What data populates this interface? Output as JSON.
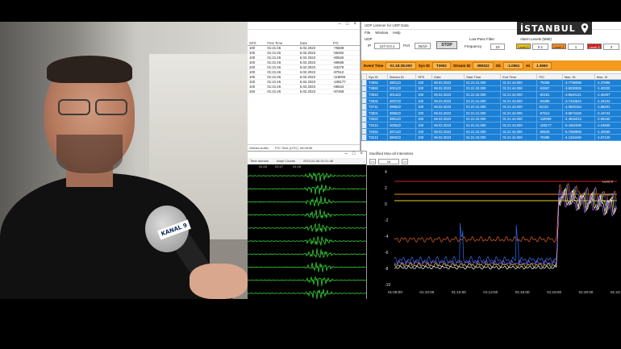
{
  "overlay": {
    "location": "İSTANBUL"
  },
  "camera": {
    "mic_label": "KANAL 9"
  },
  "list_window": {
    "title_controls": [
      "–",
      "□",
      "×"
    ],
    "columns": [
      "SPS",
      "First Time",
      "Date",
      "P/C"
    ],
    "rows": [
      [
        "100",
        "01:21:45",
        "6.02.2023",
        "-75508"
      ],
      [
        "100",
        "01:21:45",
        "6.02.2023",
        "-56492"
      ],
      [
        "100",
        "01:21:45",
        "6.02.2023",
        "-80526"
      ],
      [
        "100",
        "01:21:46",
        "6.02.2023",
        "-69686"
      ],
      [
        "100",
        "01:21:46",
        "6.02.2023",
        "-53279"
      ],
      [
        "100",
        "01:21:46",
        "6.02.2023",
        "-87512"
      ],
      [
        "100",
        "01:21:46",
        "6.02.2023",
        "-118006"
      ],
      [
        "100",
        "01:21:45",
        "6.02.2023",
        "-108177"
      ],
      [
        "100",
        "01:21:45",
        "6.02.2023",
        "-68634"
      ],
      [
        "150",
        "01:21:46",
        "6.02.2023",
        "-87458"
      ]
    ],
    "status": [
      "Stream buffer",
      "P/C Time (UTC): 06:08:56"
    ]
  },
  "udp_window": {
    "title": "UDP Listener for UDP Data",
    "menu": [
      "File",
      "Window",
      "Help"
    ],
    "udp_label": "UDP",
    "ip_label": "IP",
    "ip_value": "127.0.0.1",
    "port_label": "Port",
    "port_value": "26/10",
    "stop_label": "STOP",
    "lowpass_label": "Low-Pass Filter",
    "frequency_label": "Frequency",
    "frequency_value": "10",
    "alarm_label": "Alarm Levels (MMI)",
    "levels": [
      {
        "label": "Level 0",
        "value": "0.1",
        "color": "#e8c020"
      },
      {
        "label": "Level 2",
        "value": "1",
        "color": "#f08a20"
      },
      {
        "label": "Level 3",
        "value": "3",
        "color": "#d42020"
      }
    ],
    "info": {
      "event_time_label": "Event Time",
      "event_time_value": "01:18:28.000",
      "sys_id_label": "Sys ID",
      "sys_id_value": "T3902",
      "stream_id_label": "Stream ID",
      "stream_id_value": "398322",
      "ok_label": "Ok",
      "ok_value": "-1.0961",
      "hi_label": "Hi",
      "hi_value": "1.3650"
    },
    "columns": [
      "Sys ID",
      "Stream ID",
      "SPS",
      "Date",
      "Start Time",
      "End Time",
      "P/C",
      "Max. Dt",
      "Max. I/t"
    ],
    "rows": [
      [
        "T4062",
        "3801Z2",
        "100",
        "06.02.2023",
        "01:21:41.000",
        "01:21:43.000",
        "-76308",
        "-3.7799086",
        "-1.37596"
      ],
      [
        "T3882",
        "3001Z2",
        "100",
        "06.02.2023",
        "01:21:42.000",
        "01:21:44.000",
        "-53557",
        "-3.6030835",
        "-1.40330"
      ],
      [
        "T3942",
        "4014Z2",
        "100",
        "06.02.2023",
        "01:21:42.000",
        "01:21:44.000",
        "-60181",
        "-3.6540141",
        "-1.45407"
      ],
      [
        "T3632",
        "4007Z2",
        "100",
        "06.02.2023",
        "01:21:41.000",
        "01:21:43.000",
        "-54686",
        "-3.7410544",
        "-1.34102"
      ],
      [
        "T3711",
        "3985Z2",
        "100",
        "06.02.2023",
        "01:21:41.000",
        "01:21:43.000",
        "92119",
        "-4.0620154",
        "-1.86201"
      ],
      [
        "T3601",
        "3885Z2",
        "100",
        "06.02.2023",
        "01:21:41.000",
        "01:21:43.000",
        "-67512",
        "-3.5874426",
        "-2.16744"
      ],
      [
        "T3522",
        "3991Z2",
        "100",
        "06.02.2023",
        "01:21:42.000",
        "01:21:44.000",
        "-119009",
        "-4.4815012",
        "-2.06150"
      ],
      [
        "T3412",
        "4005Z2",
        "100",
        "06.02.2023",
        "01:21:41.000",
        "01:21:43.000",
        "-108177",
        "-5.4492030",
        "-1.04605"
      ],
      [
        "T3352",
        "3871Z2",
        "100",
        "06.02.2023",
        "01:21:42.000",
        "01:21:44.000",
        "-68526",
        "-5.7068986",
        "-1.40060"
      ],
      [
        "T3212",
        "3800Z2",
        "100",
        "06.02.2023",
        "01:21:43.000",
        "01:21:42.000",
        "-70285",
        "-4.1334440",
        "-1.67120"
      ]
    ]
  },
  "seismogram_window": {
    "title_controls": [
      "–",
      "□",
      "×"
    ],
    "toolbar": [
      "Time domain",
      "Ampl Counts",
      "2023-02-06 01:21:46"
    ],
    "time_ticks": [
      "01:16",
      "01:17",
      "01:18"
    ],
    "trace_color": "#39e639",
    "trace_count": 10
  },
  "maxall_window": {
    "title": "Modified Max-all Intensities",
    "nav_prev": "<<",
    "nav_value": "16",
    "nav_next": ">>",
    "chart_data": {
      "type": "line",
      "ylim": [
        -10,
        4
      ],
      "y_ticks": [
        "4",
        "2",
        "0",
        "-2",
        "-4",
        "-6",
        "-8",
        "-10"
      ],
      "x_ticks": [
        "01:08:00",
        "01:10:00",
        "01:12:00",
        "01:14:00",
        "01:16:00",
        "01:18:00",
        "01:20:00",
        "01:22:00"
      ],
      "thresholds": [
        {
          "name": "Level 3",
          "value": 2.8,
          "color": "#d42020"
        },
        {
          "name": "Level 2",
          "value": 1.2,
          "color": "#f08a20"
        },
        {
          "name": "Level 1",
          "value": 0.4,
          "color": "#e8d020"
        }
      ],
      "series": [
        {
          "color": "#e0602a"
        },
        {
          "color": "#2f6ff0"
        },
        {
          "color": "#f2e25a"
        },
        {
          "color": "#ffffff"
        },
        {
          "color": "#a060e0"
        }
      ]
    }
  }
}
